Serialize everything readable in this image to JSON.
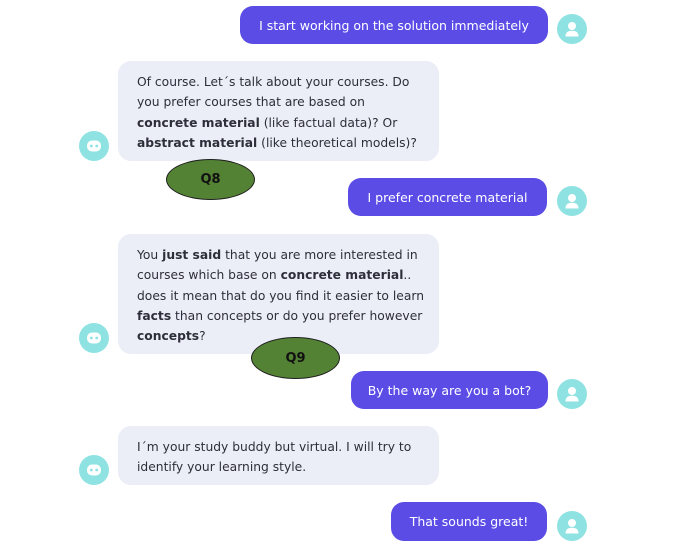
{
  "messages": [
    {
      "sender": "user",
      "text": "I start working on the solution immediately"
    },
    {
      "sender": "bot",
      "segments": [
        {
          "text": "Of course. Let´s talk about your courses. Do you prefer courses that are based on ",
          "bold": false
        },
        {
          "text": "concrete material",
          "bold": true
        },
        {
          "text": " (like factual data)? Or ",
          "bold": false
        },
        {
          "text": "abstract material",
          "bold": true
        },
        {
          "text": " (like theoretical models)?",
          "bold": false
        }
      ]
    },
    {
      "sender": "user",
      "text": "I prefer concrete material"
    },
    {
      "sender": "bot",
      "segments": [
        {
          "text": "You ",
          "bold": false
        },
        {
          "text": "just said",
          "bold": true
        },
        {
          "text": " that you are more interested in courses which base on ",
          "bold": false
        },
        {
          "text": "concrete material",
          "bold": true
        },
        {
          "text": ".. does it mean that do you find it easier to learn ",
          "bold": false
        },
        {
          "text": "facts",
          "bold": true
        },
        {
          "text": " than concepts or do you prefer however ",
          "bold": false
        },
        {
          "text": "concepts",
          "bold": true
        },
        {
          "text": "?",
          "bold": false
        }
      ]
    },
    {
      "sender": "user",
      "text": "By the way are you a bot?"
    },
    {
      "sender": "bot",
      "segments": [
        {
          "text": "I´m your study buddy but virtual. I will try to identify your learning style.",
          "bold": false
        }
      ]
    },
    {
      "sender": "user",
      "text": "That sounds great!"
    }
  ],
  "annotations": {
    "q8": "Q8",
    "q9": "Q9"
  },
  "colors": {
    "user_bubble": "#5b4ce6",
    "bot_bubble": "#eceef7",
    "avatar": "#8ee2e2",
    "badge": "#548235"
  },
  "icons": {
    "user_avatar": "person-icon",
    "bot_avatar": "robot-icon"
  }
}
